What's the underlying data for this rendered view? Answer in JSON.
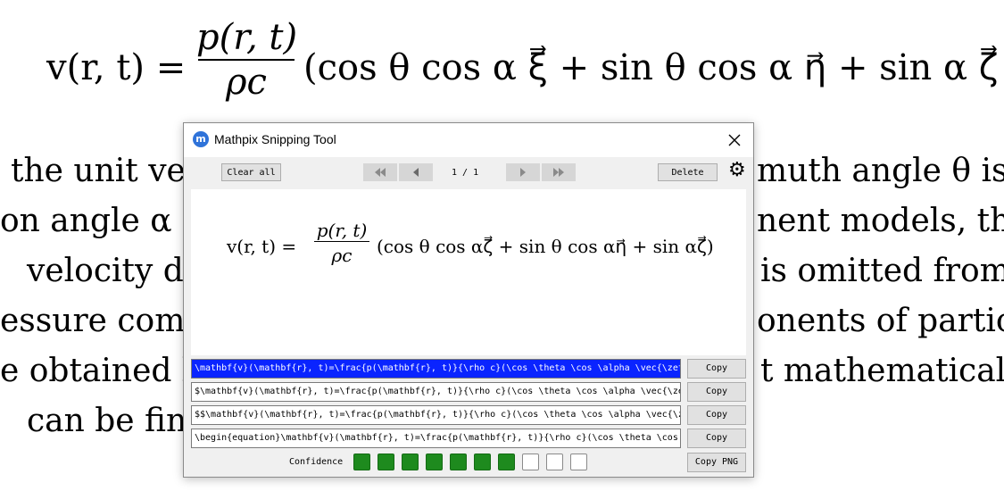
{
  "document": {
    "equation": {
      "lhs": "v(r, t) =",
      "numerator": "p(r, t)",
      "denominator": "ρc",
      "rest": "(cos θ cos α ξ⃗ + sin θ cos α η⃗ + sin α ζ⃗ )"
    },
    "lines": [
      "the unit ve",
      "muth angle θ is",
      "on angle α i",
      "nent models, the",
      "velocity de",
      "is omitted from",
      "essure com",
      "onents of partic",
      "e obtained l",
      "t mathematical",
      "can be final"
    ]
  },
  "window": {
    "title": "Mathpix Snipping Tool",
    "toolbar": {
      "clear_all": "Clear all",
      "page_indicator": "1 / 1",
      "delete": "Delete"
    },
    "preview": {
      "lhs": "v(r, t) =",
      "numerator": "p(r, t)",
      "denominator": "ρc",
      "rest": "(cos θ cos αζ⃗ + sin θ cos αη⃗ + sin αζ⃗)"
    },
    "latex_rows": [
      "\\mathbf{v}(\\mathbf{r}, t)=\\frac{p(\\mathbf{r}, t)}{\\rho c}(\\cos \\theta \\cos \\alpha \\vec{\\zeta}",
      "$\\mathbf{v}(\\mathbf{r}, t)=\\frac{p(\\mathbf{r}, t)}{\\rho c}(\\cos \\theta \\cos \\alpha \\vec{\\ze",
      "$$\\mathbf{v}(\\mathbf{r}, t)=\\frac{p(\\mathbf{r}, t)}{\\rho c}(\\cos \\theta \\cos \\alpha \\vec{\\z",
      "\\begin{equation}\\mathbf{v}(\\mathbf{r}, t)=\\frac{p(\\mathbf{r}, t)}{\\rho c}(\\cos \\theta \\cos"
    ],
    "copy_label": "Copy",
    "confidence_label": "Confidence",
    "confidence_filled": 7,
    "confidence_total": 10,
    "copy_png": "Copy PNG",
    "colors": {
      "selected_row": "#0a24ff",
      "confidence_on": "#1e8a1e"
    }
  }
}
